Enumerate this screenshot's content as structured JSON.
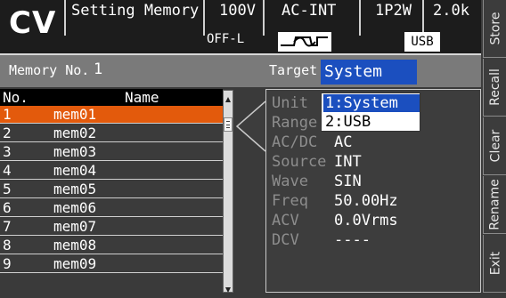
{
  "header": {
    "mode": "CV",
    "screen_title": "Setting Memory",
    "voltage_range": "100V",
    "input": "AC-INT",
    "wiring": "1P2W",
    "freq": "2.0k",
    "output_status": "OFF-L",
    "usb": "USB"
  },
  "memory": {
    "label": "Memory No.",
    "number": "1",
    "target_label": "Target",
    "target_value": "System"
  },
  "list": {
    "col_no": "No.",
    "col_name": "Name",
    "rows": [
      {
        "no": "1",
        "name": "mem01"
      },
      {
        "no": "2",
        "name": "mem02"
      },
      {
        "no": "3",
        "name": "mem03"
      },
      {
        "no": "4",
        "name": "mem04"
      },
      {
        "no": "5",
        "name": "mem05"
      },
      {
        "no": "6",
        "name": "mem06"
      },
      {
        "no": "7",
        "name": "mem07"
      },
      {
        "no": "8",
        "name": "mem08"
      },
      {
        "no": "9",
        "name": "mem09"
      }
    ]
  },
  "detail": {
    "unit_label": "Unit",
    "range_label": "Range",
    "acdc_label": "AC/DC",
    "acdc_value": "AC",
    "source_label": "Source",
    "source_value": "INT",
    "wave_label": "Wave",
    "wave_value": "SIN",
    "freq_label": "Freq",
    "freq_value": "50.00Hz",
    "acv_label": "ACV",
    "acv_value": "0.0Vrms",
    "dcv_label": "DCV",
    "dcv_value": "----"
  },
  "dropdown": {
    "options": [
      "1:System",
      "2:USB"
    ]
  },
  "softkeys": [
    "Store",
    "Recall",
    "Clear",
    "Rename",
    "Exit"
  ],
  "colors": {
    "selected_row": "#e35a0c",
    "dropdown_highlight": "#1b4fbf",
    "target_field": "#1b4fbf"
  }
}
